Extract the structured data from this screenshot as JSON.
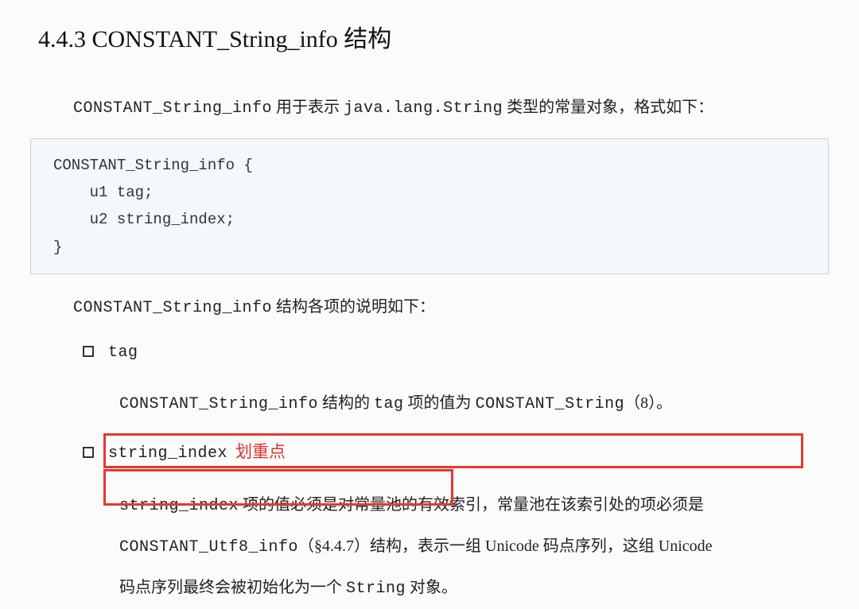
{
  "heading": "4.4.3 CONSTANT_String_info 结构",
  "intro": {
    "prefix": "CONSTANT_String_info",
    "mid": " 用于表示 ",
    "javaClass": "java.lang.String",
    "suffix": " 类型的常量对象，格式如下："
  },
  "code": "CONSTANT_String_info {\n    u1 tag;\n    u2 string_index;\n}",
  "explain": {
    "prefix": "CONSTANT_String_info",
    "suffix": " 结构各项的说明如下："
  },
  "items": [
    {
      "label": "tag",
      "desc": {
        "p1a": "CONSTANT_String_info",
        "p1b": " 结构的 ",
        "p1c": "tag",
        "p1d": " 项的值为 ",
        "p1e": "CONSTANT_String",
        "p1f": "（8）。"
      }
    },
    {
      "label": "string_index",
      "annot": "划重点",
      "desc": {
        "p1a": "string_index",
        "p1b": " 项的值必须是对常量池的有效索引，常量池在该索引处的项必须是 ",
        "p2a": "CONSTANT_Utf8_info",
        "p2b": "（§4.4.7）结构",
        "p2c": "，表示一组 Unicode 码点序列，这组 Unicode",
        "p3": "码点序列最终会被初始化为一个 ",
        "p3a": "String",
        "p3b": " 对象。"
      }
    }
  ]
}
